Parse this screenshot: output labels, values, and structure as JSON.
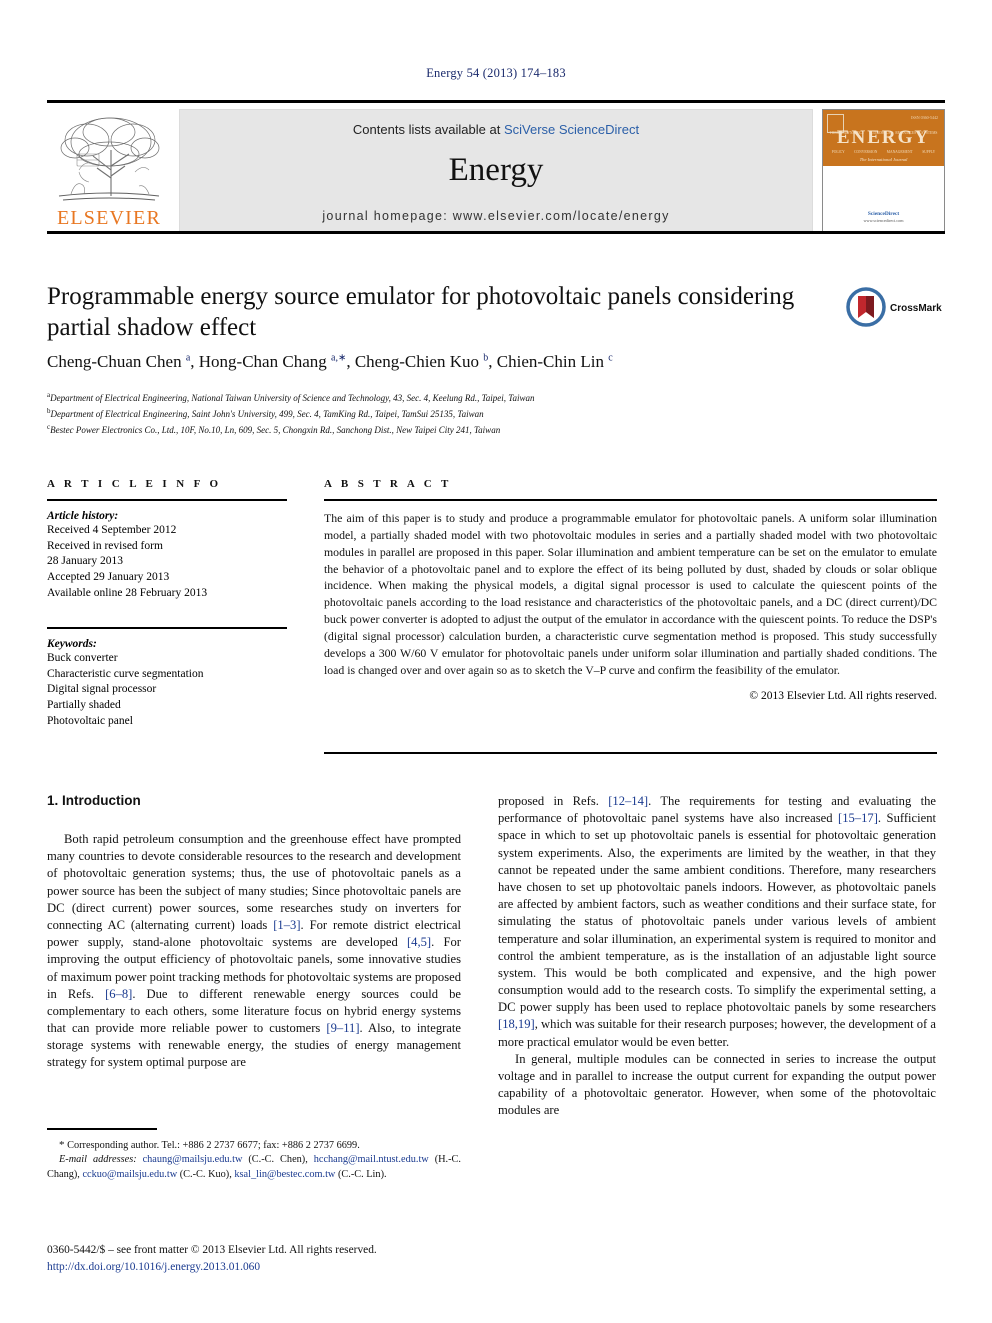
{
  "running_head": "Energy 54 (2013) 174–183",
  "masthead": {
    "contents_prefix": "Contents lists available at ",
    "contents_link": "SciVerse ScienceDirect",
    "journal_name": "Energy",
    "homepage": "journal homepage: www.elsevier.com/locate/energy",
    "publisher_wordmark": "ELSEVIER",
    "cover": {
      "title": "ENERGY",
      "subtitle": "The International Journal",
      "issn_corner": "ISSN 0360-5442",
      "row_labels": [
        "THERMODYNAMICS",
        "ECONOMICS",
        "RESOURCES",
        "SYSTEMS",
        "POLICY",
        "CONVERSION",
        "MANAGEMENT",
        "SUPPLY"
      ],
      "available_online": "Available online at",
      "sciencedirect": "ScienceDirect",
      "url": "www.sciencedirect.com"
    }
  },
  "article": {
    "title": "Programmable energy source emulator for photovoltaic panels considering partial shadow effect",
    "crossmark_label": "CrossMark",
    "authors_html": "Cheng-Chuan Chen <sup>a</sup>, Hong-Chan Chang <sup>a,∗</sup>, Cheng-Chien Kuo <sup>b</sup>, Chien-Chin Lin <sup>c</sup>",
    "affiliations": [
      {
        "marker": "a",
        "text": "Department of Electrical Engineering, National Taiwan University of Science and Technology, 43, Sec. 4, Keelung Rd., Taipei, Taiwan"
      },
      {
        "marker": "b",
        "text": "Department of Electrical Engineering, Saint John's University, 499, Sec. 4, TamKing Rd., Taipei, TamSui 25135, Taiwan"
      },
      {
        "marker": "c",
        "text": "Bestec Power Electronics Co., Ltd., 10F, No.10, Ln, 609, Sec. 5, Chongxin Rd., Sanchong Dist., New Taipei City 241, Taiwan"
      }
    ]
  },
  "article_info": {
    "heading": "A R T I C L E  I N F O",
    "history_label": "Article history:",
    "history": [
      "Received 4 September 2012",
      "Received in revised form",
      "28 January 2013",
      "Accepted 29 January 2013",
      "Available online 28 February 2013"
    ],
    "keywords_label": "Keywords:",
    "keywords": [
      "Buck converter",
      "Characteristic curve segmentation",
      "Digital signal processor",
      "Partially shaded",
      "Photovoltaic panel"
    ]
  },
  "abstract": {
    "heading": "A B S T R A C T",
    "text": "The aim of this paper is to study and produce a programmable emulator for photovoltaic panels. A uniform solar illumination model, a partially shaded model with two photovoltaic modules in series and a partially shaded model with two photovoltaic modules in parallel are proposed in this paper. Solar illumination and ambient temperature can be set on the emulator to emulate the behavior of a photovoltaic panel and to explore the effect of its being polluted by dust, shaded by clouds or solar oblique incidence. When making the physical models, a digital signal processor is used to calculate the quiescent points of the photovoltaic panels according to the load resistance and characteristics of the photovoltaic panels, and a DC (direct current)/DC buck power converter is adopted to adjust the output of the emulator in accordance with the quiescent points. To reduce the DSP's (digital signal processor) calculation burden, a characteristic curve segmentation method is proposed. This study successfully develops a 300 W/60 V emulator for photovoltaic panels under uniform solar illumination and partially shaded conditions. The load is changed over and over again so as to sketch the V–P curve and confirm the feasibility of the emulator.",
    "copyright": "© 2013 Elsevier Ltd. All rights reserved."
  },
  "introduction": {
    "section_title": "1. Introduction",
    "left_paragraph_html": "Both rapid petroleum consumption and the greenhouse effect have prompted many countries to devote considerable resources to the research and development of photovoltaic generation systems; thus, the use of photovoltaic panels as a power source has been the subject of many studies; Since photovoltaic panels are DC (direct current) power sources, some researches study on inverters for connecting AC (alternating current) loads <span class=\"ref\">[1–3]</span>. For remote district electrical power supply, stand-alone photovoltaic systems are developed <span class=\"ref\">[4,5]</span>. For improving the output efficiency of photovoltaic panels, some innovative studies of maximum power point tracking methods for photovoltaic systems are proposed in Refs. <span class=\"ref\">[6–8]</span>. Due to different renewable energy sources could be complementary to each others, some literature focus on hybrid energy systems that can provide more reliable power to customers <span class=\"ref\">[9–11]</span>. Also, to integrate storage systems with renewable energy, the studies of energy management strategy for system optimal purpose are",
    "right_paragraph_1_html": "proposed in Refs. <span class=\"ref\">[12–14]</span>. The requirements for testing and evaluating the performance of photovoltaic panel systems have also increased <span class=\"ref\">[15–17]</span>. Sufficient space in which to set up photovoltaic panels is essential for photovoltaic generation system experiments. Also, the experiments are limited by the weather, in that they cannot be repeated under the same ambient conditions. Therefore, many researchers have chosen to set up photovoltaic panels indoors. However, as photovoltaic panels are affected by ambient factors, such as weather conditions and their surface state, for simulating the status of photovoltaic panels under various levels of ambient temperature and solar illumination, an experimental system is required to monitor and control the ambient temperature, as is the installation of an adjustable light source system. This would be both complicated and expensive, and the high power consumption would add to the research costs. To simplify the experimental setting, a DC power supply has been used to replace photovoltaic panels by some researchers <span class=\"ref\">[18,19]</span>, which was suitable for their research purposes; however, the development of a more practical emulator would be even better.",
    "right_paragraph_2_html": "In general, multiple modules can be connected in series to increase the output voltage and in parallel to increase the output current for expanding the output power capability of a photovoltaic generator. However, when some of the photovoltaic modules are"
  },
  "footnotes": {
    "corresponding_html": "<span style=\"font-size:11px\">*</span> Corresponding author. Tel.: +886 2 2737 6677; fax: +886 2 2737 6699.",
    "emails_html": "<span class=\"fn-em\">E-mail addresses:</span> <span class=\"mail\">chaung@mailsju.edu.tw</span> (C.-C. Chen), <span class=\"mail\">hcchang@mail.ntust.edu.tw</span> (H.-C. Chang), <span class=\"mail\">cckuo@mailsju.edu.tw</span> (C.-C. Kuo), <span class=\"mail\">ksal_lin@bestec.com.tw</span> (C.-C. Lin)."
  },
  "front_matter": {
    "line1": "0360-5442/$ – see front matter © 2013 Elsevier Ltd. All rights reserved.",
    "doi": "http://dx.doi.org/10.1016/j.energy.2013.01.060"
  }
}
